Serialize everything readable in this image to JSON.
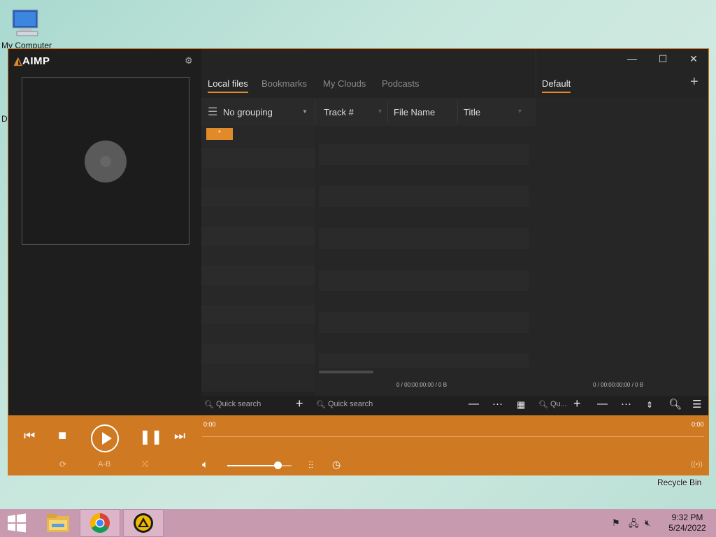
{
  "desktop": {
    "my_computer_label": "My Computer",
    "recycle_bin_label": "Recycle Bin",
    "edge_letter": "D"
  },
  "app": {
    "logo": "AIMP",
    "logo_mark": "◭",
    "gear": "⚙",
    "window_controls": {
      "minimize": "—",
      "maximize": "☐",
      "close": "✕"
    }
  },
  "library": {
    "tabs": [
      {
        "label": "Local files",
        "active": true
      },
      {
        "label": "Bookmarks",
        "active": false
      },
      {
        "label": "My Clouds",
        "active": false
      },
      {
        "label": "Podcasts",
        "active": false
      }
    ],
    "grouping_label": "No grouping",
    "columns": [
      "Track #",
      "File Name",
      "Title"
    ],
    "group_badge": "*",
    "status": "0 / 00:00:00:00 / 0 B"
  },
  "playlist": {
    "tab_label": "Default",
    "add_icon": "+",
    "status": "0 / 00:00:00:00 / 0 B"
  },
  "toolbar": {
    "quick_search_1": "Quick search",
    "quick_search_2": "Quick search",
    "quick_search_3": "Qu..."
  },
  "player": {
    "time_left": "0:00",
    "time_right": "0:00",
    "ab_label": "A-B",
    "volume_fraction": 0.78
  },
  "taskbar": {
    "time": "9:32 PM",
    "date": "5/24/2022"
  }
}
